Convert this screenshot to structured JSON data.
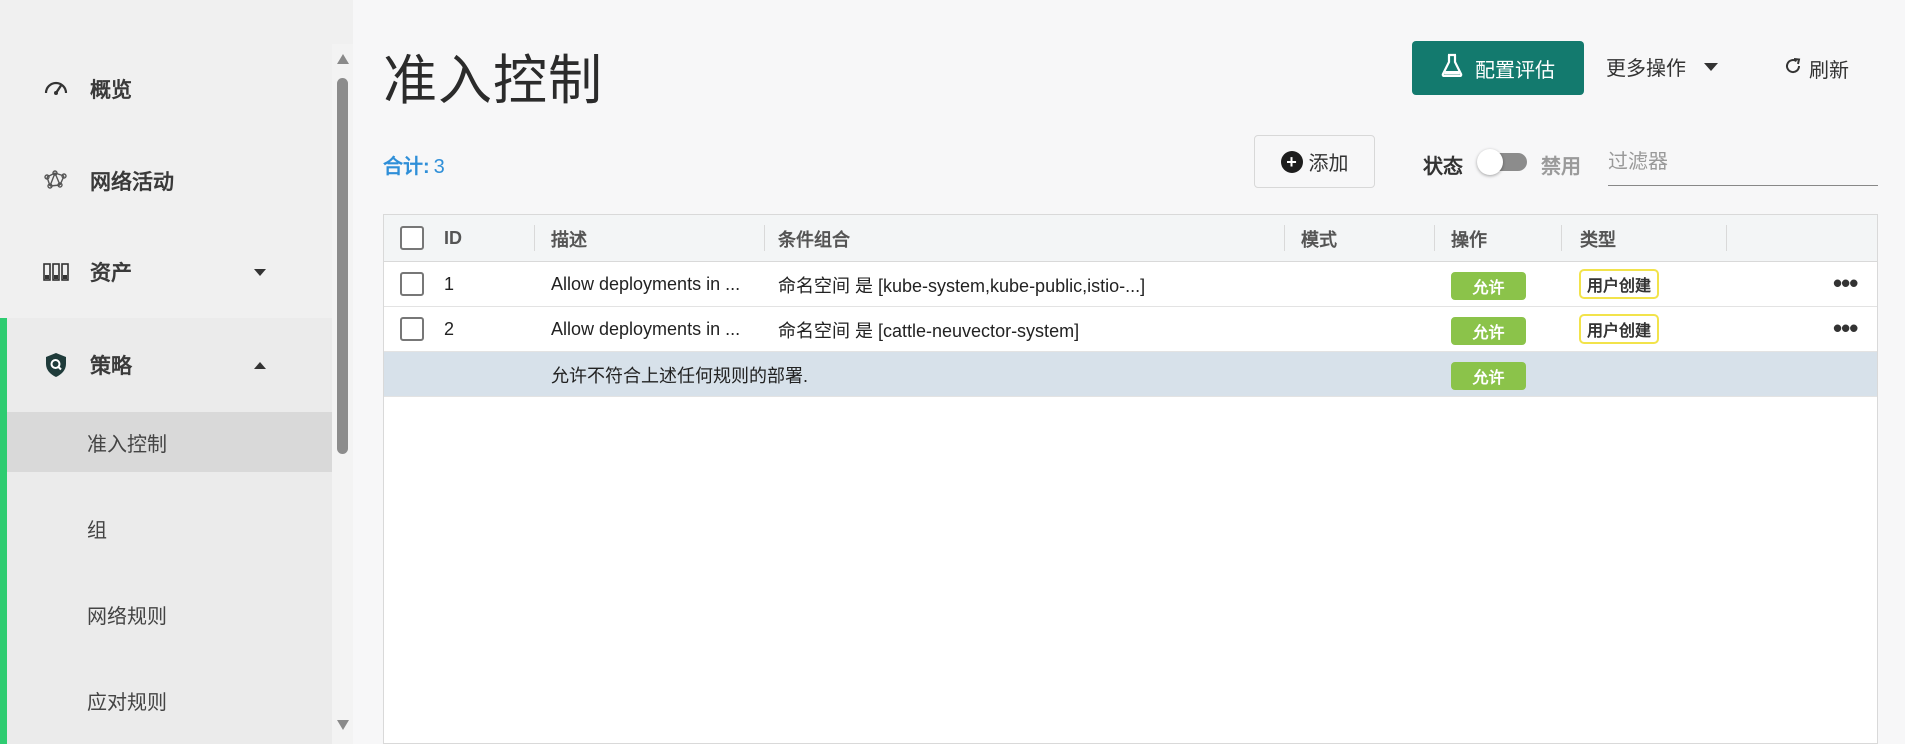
{
  "sidebar": {
    "items": [
      {
        "label": "概览",
        "icon": "dashboard-icon"
      },
      {
        "label": "网络活动",
        "icon": "network-activity-icon"
      },
      {
        "label": "资产",
        "icon": "assets-icon"
      },
      {
        "label": "策略",
        "icon": "policy-icon"
      }
    ],
    "sub_items": [
      "准入控制",
      "组",
      "网络规则",
      "应对规则"
    ]
  },
  "header": {
    "title": "准入控制",
    "config_button": "配置评估",
    "more_actions": "更多操作",
    "refresh": "刷新"
  },
  "toolbar": {
    "total_label": "合计:",
    "total_count": "3",
    "add_button": "添加",
    "status_label": "状态",
    "status_value": "禁用",
    "filter_placeholder": "过滤器"
  },
  "table": {
    "columns": [
      "ID",
      "描述",
      "条件组合",
      "模式",
      "操作",
      "类型"
    ],
    "rows": [
      {
        "id": "1",
        "desc": "Allow deployments in ...",
        "criteria": "命名空间 是 [kube-system,kube-public,istio-...]",
        "mode": "",
        "action": "允许",
        "type": "用户创建"
      },
      {
        "id": "2",
        "desc": "Allow deployments in ...",
        "criteria": "命名空间 是 [cattle-neuvector-system]",
        "mode": "",
        "action": "允许",
        "type": "用户创建"
      }
    ],
    "default_row": {
      "desc": "允许不符合上述任何规则的部署.",
      "action": "允许"
    },
    "more_symbol": "•••"
  },
  "colors": {
    "accent": "#137a6e",
    "sidebar_active_bar": "#2ecc71",
    "total_text": "#2f8fd8",
    "allow_badge": "#8bc34a",
    "user_badge_border": "#f2e34b"
  }
}
